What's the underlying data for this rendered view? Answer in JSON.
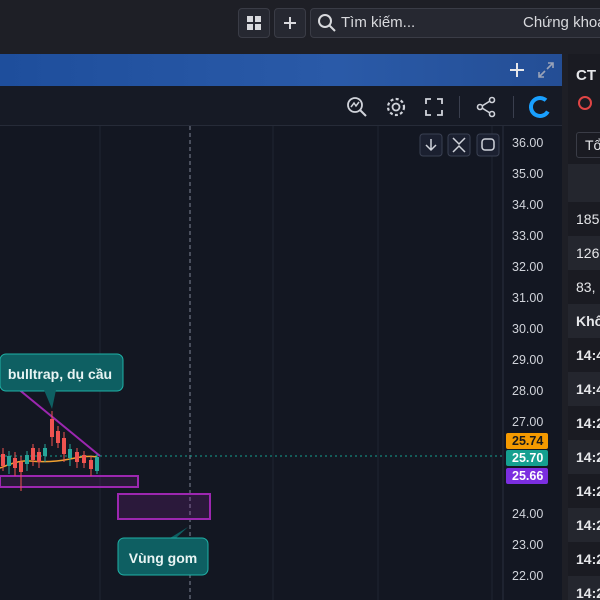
{
  "header": {
    "search_placeholder": "Tìm kiếm...",
    "search_category": "Chứng khoá"
  },
  "chart": {
    "price_axis_labels": [
      "36.00",
      "35.00",
      "34.00",
      "33.00",
      "32.00",
      "31.00",
      "30.00",
      "29.00",
      "28.00",
      "27.00",
      "24.00",
      "23.00",
      "22.00"
    ],
    "price_tags": [
      {
        "value": "25.74",
        "color": "#f59a00"
      },
      {
        "value": "25.70",
        "color": "#15a090"
      },
      {
        "value": "25.66",
        "color": "#7b2ee0"
      }
    ],
    "annotations": {
      "bulltrap": "bulltrap, dụ cầu",
      "vung_gom": "Vùng gom"
    },
    "colors": {
      "bullish": "#26a69a",
      "bearish": "#ef5350",
      "trendline": "#9c27b0",
      "zone": "#9c27b0",
      "ma": "#f0a030"
    }
  },
  "right_panel": {
    "title": "CT",
    "filter": "Tổ",
    "values": [
      "185",
      "126",
      "83,"
    ],
    "section": "Khố",
    "times": [
      "14:4",
      "14:4",
      "14:2",
      "14:2",
      "14:2",
      "14:2",
      "14:2",
      "14:2"
    ]
  }
}
